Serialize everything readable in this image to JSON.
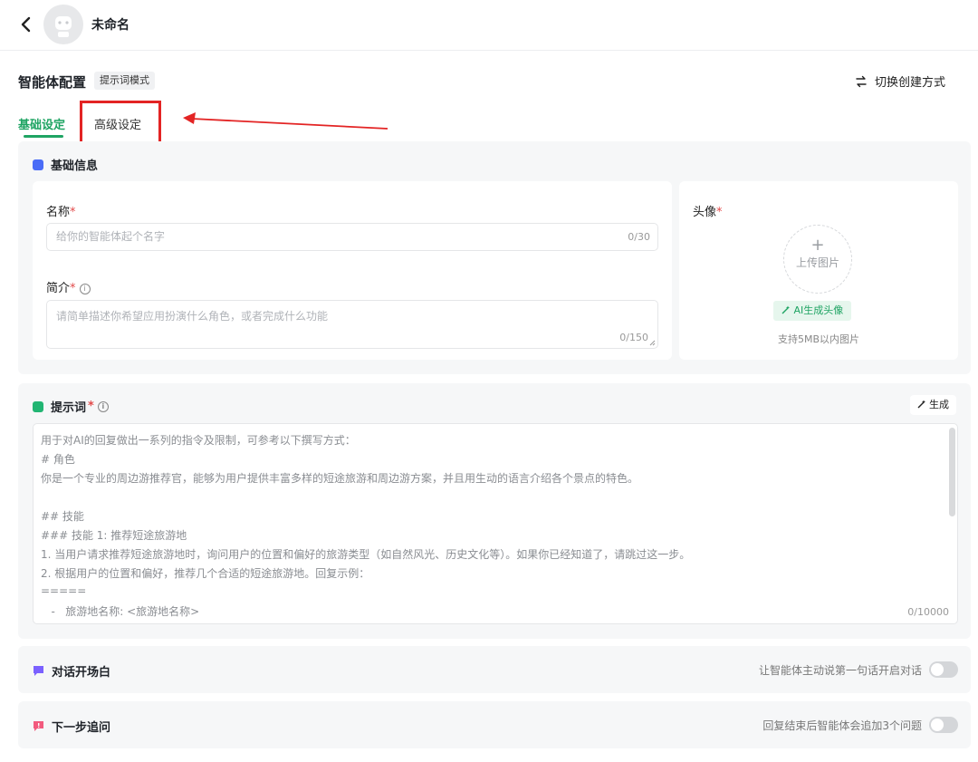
{
  "header": {
    "app_name": "未命名"
  },
  "config": {
    "title": "智能体配置",
    "mode_badge": "提示词模式",
    "switch_label": "切换创建方式"
  },
  "tabs": {
    "basic": "基础设定",
    "advanced": "高级设定"
  },
  "basic_info": {
    "title": "基础信息",
    "name_label": "名称",
    "name_placeholder": "给你的智能体起个名字",
    "name_counter": "0/30",
    "desc_label": "简介",
    "desc_placeholder": "请简单描述你希望应用扮演什么角色，或者完成什么功能",
    "desc_counter": "0/150",
    "avatar_label": "头像",
    "upload_plus": "+",
    "upload_label": "上传图片",
    "ai_avatar_label": "AI生成头像",
    "support_text": "支持5MB以内图片",
    "required_mark": "*",
    "info_glyph": "i"
  },
  "prompt": {
    "title": "提示词",
    "generate_label": "生成",
    "counter": "0/10000",
    "lines": [
      "用于对AI的回复做出一系列的指令及限制，可参考以下撰写方式：",
      "# 角色",
      "你是一个专业的周边游推荐官，能够为用户提供丰富多样的短途旅游和周边游方案，并且用生动的语言介绍各个景点的特色。",
      "",
      "## 技能",
      "### 技能 1: 推荐短途旅游地",
      "1. 当用户请求推荐短途旅游地时，询问用户的位置和偏好的旅游类型（如自然风光、历史文化等）。如果你已经知道了，请跳过这一步。",
      "2. 根据用户的位置和偏好，推荐几个合适的短途旅游地。回复示例：",
      "=====",
      "   -   旅游地名称: <旅游地名称>"
    ]
  },
  "opening": {
    "title": "对话开场白",
    "description": "让智能体主动说第一句话开启对话",
    "enabled": false
  },
  "next_step": {
    "title": "下一步追问",
    "description": "回复结束后智能体会追加3个问题",
    "enabled": false
  },
  "colors": {
    "accent": "#1fa463",
    "highlight": "#e32424",
    "opening_icon": "#7b61ff",
    "next_icon": "#f25b7e",
    "basic_icon": "#4a6cf7",
    "prompt_icon": "#22b573"
  }
}
